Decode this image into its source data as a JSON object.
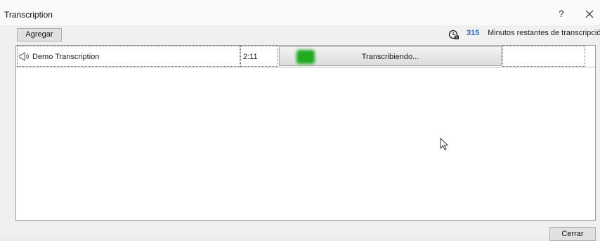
{
  "window": {
    "title": "Transcription",
    "help_label": "?",
    "close_icon": "close-icon"
  },
  "toolbar": {
    "add_label": "Agregar",
    "remaining_icon": "clock-icon",
    "remaining_count": "315",
    "remaining_label": "Minutos restantes de transcripción"
  },
  "list": {
    "items": [
      {
        "icon": "speaker-icon",
        "name": "Demo Transcription",
        "duration": "2:11",
        "status": "Transcribiendo..."
      }
    ]
  },
  "footer": {
    "close_label": "Cerrar"
  },
  "colors": {
    "accent": "#2667b8",
    "progress": "#1faa1f"
  }
}
